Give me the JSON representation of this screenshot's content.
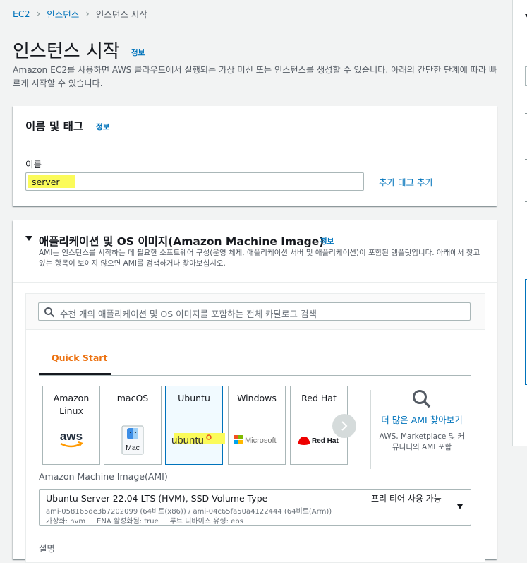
{
  "breadcrumb": [
    "EC2",
    "인스턴스",
    "인스턴스 시작"
  ],
  "page": {
    "title": "인스턴스 시작",
    "info": "정보",
    "intro": "Amazon EC2를 사용하면 AWS 클라우드에서 실행되는 가상 머신 또는 인스턴스를 생성할 수 있습니다. 아래의 간단한 단계에 따라 빠르게 시작할 수 있습니다."
  },
  "name_panel": {
    "title": "이름 및 태그",
    "info": "정보",
    "name_label": "이름",
    "name_value": "server",
    "add_tag": "추가 태그 추가"
  },
  "ami_panel": {
    "title": "애플리케이션 및 OS 이미지(Amazon Machine Image)",
    "info": "정보",
    "description": "AMI는 인스턴스를 시작하는 데 필요한 소프트웨어 구성(운영 체제, 애플리케이션 서버 및 애플리케이션)이 포함된 템플릿입니다. 아래에서 찾고 있는 항목이 보이지 않으면 AMI를 검색하거나 찾아보십시오.",
    "search_placeholder": "수천 개의 애플리케이션 및 OS 이미지를 포함하는 전체 카탈로그 검색",
    "tab": "Quick Start",
    "tiles": [
      {
        "name": "Amazon Linux",
        "logo": "aws"
      },
      {
        "name": "macOS",
        "logo": "Mac"
      },
      {
        "name": "Ubuntu",
        "logo": "ubuntu"
      },
      {
        "name": "Windows",
        "logo": "Microsoft"
      },
      {
        "name": "Red Hat",
        "logo": "Red Hat"
      }
    ],
    "more_link": "더 많은 AMI 찾아보기",
    "more_sub": "AWS, Marketplace 및 커뮤니티의 AMI 포함",
    "ami_label": "Amazon Machine Image(AMI)",
    "ami_name": "Ubuntu Server 22.04 LTS (HVM), SSD Volume Type",
    "ami_badge": "프리 티어 사용 가능",
    "ami_ids": "ami-058165de3b7202099 (64비트(x86)) / ami-04c65fa50a4122444 (64비트(Arm))",
    "ami_meta": "가상화: hvm     ENA 활성화됨: true     루트 디바이스 유형: ebs",
    "desc_label": "설명"
  },
  "colors": {
    "accent": "#ec7211",
    "link": "#0073bb",
    "highlight": "#fbfb5a"
  }
}
